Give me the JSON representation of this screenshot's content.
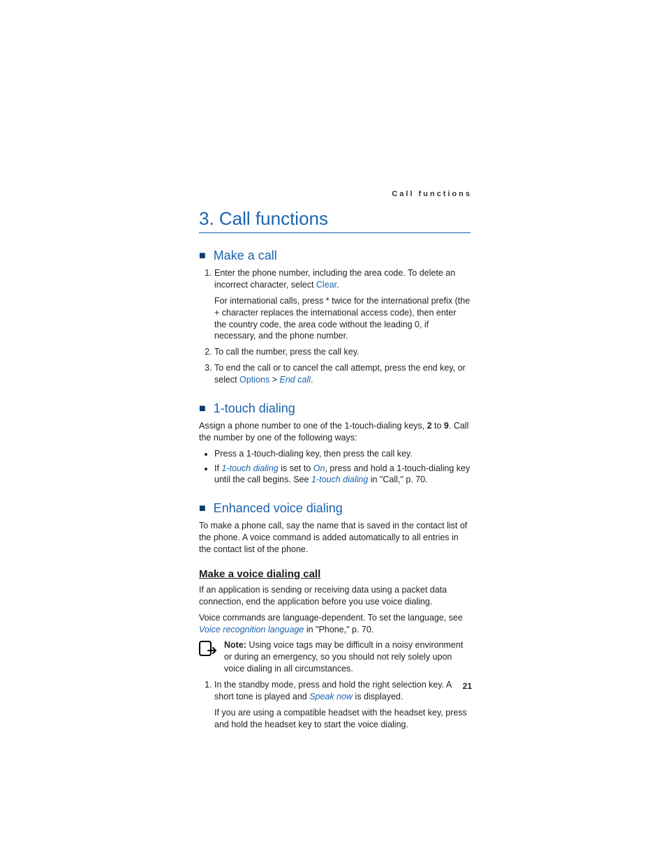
{
  "running_head": "Call functions",
  "chapter_title": "3.   Call functions",
  "page_number": "21",
  "sec1": {
    "title": "Make a call",
    "li1_a": "Enter the phone number, including the area code. To delete an incorrect character, select ",
    "li1_link": "Clear",
    "li1_b": ".",
    "li1_p": "For international calls, press * twice for the international prefix (the + character replaces the international access code), then enter the country code, the area code without the leading 0, if necessary, and the phone number.",
    "li2": "To call the number, press the call key.",
    "li3_a": "To end the call or to cancel the call attempt, press the end key, or select ",
    "li3_link1": "Options",
    "li3_gt": " > ",
    "li3_link2": "End call",
    "li3_b": "."
  },
  "sec2": {
    "title": "1-touch dialing",
    "intro_a": "Assign a phone number to one of the 1-touch-dialing keys, ",
    "intro_k1": "2",
    "intro_mid": " to ",
    "intro_k2": "9",
    "intro_b": ". Call the number by one of the following ways:",
    "b1": "Press a 1-touch-dialing key, then press the call key.",
    "b2_a": "If ",
    "b2_link1": "1-touch dialing",
    "b2_mid1": " is set to ",
    "b2_link2": "On",
    "b2_mid2": ", press and hold a 1-touch-dialing key until the call begins. See ",
    "b2_link3": "1-touch dialing",
    "b2_b": " in \"Call,\" p. 70."
  },
  "sec3": {
    "title": "Enhanced voice dialing",
    "intro": "To make a phone call, say the name that is saved in the contact list of the phone. A voice command is added automatically to all entries in the contact list of the phone.",
    "sub_title": "Make a voice dialing call",
    "p1": "If an application is sending or receiving data using a packet data connection, end the application before you use voice dialing.",
    "p2_a": "Voice commands are language-dependent. To set the language, see ",
    "p2_link": "Voice recognition language",
    "p2_b": " in \"Phone,\" p. 70.",
    "note_label": "Note:",
    "note_text": " Using voice tags may be difficult in a noisy environment or during an emergency, so you should not rely solely upon voice dialing in all circumstances.",
    "li1_a": "In the standby mode, press and hold the right selection key. A short tone is played and ",
    "li1_link": "Speak now",
    "li1_b": " is displayed.",
    "li1_p": "If you are using a compatible headset with the headset key, press and hold the headset key to start the voice dialing."
  }
}
